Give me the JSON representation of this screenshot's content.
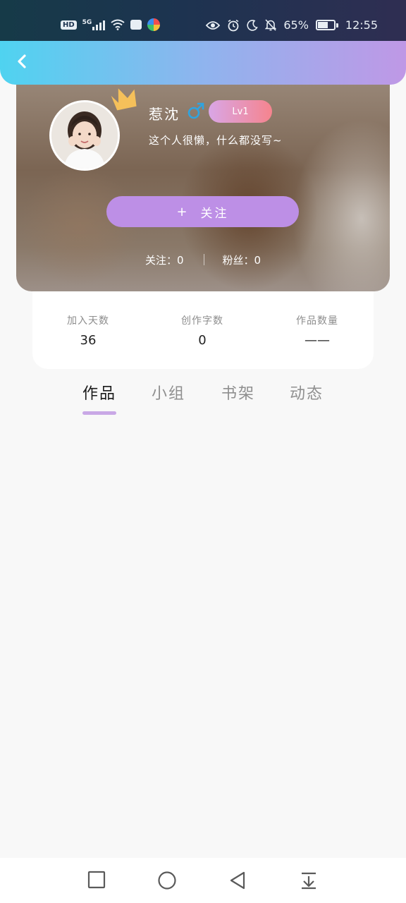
{
  "status_bar": {
    "hd": "HD",
    "network": "5G",
    "battery_percent": "65%",
    "battery_level": 0.65,
    "time": "12:55",
    "icons": [
      "hd-icon",
      "signal-icon",
      "wifi-icon",
      "app-store-icon",
      "colorful-app-icon",
      "eye-icon",
      "alarm-icon",
      "moon-icon",
      "bell-off-icon",
      "battery-icon"
    ]
  },
  "header": {
    "back_icon": "chevron-left-icon"
  },
  "profile": {
    "name": "惹沈",
    "gender_symbol": "♂",
    "level": "Lv1",
    "bio": "这个人很懒，什么都没写~",
    "follow_button": "关注",
    "follow_plus": "+",
    "following_label": "关注：",
    "following_count": "0",
    "fans_label": "粉丝：",
    "fans_count": "0",
    "colors": {
      "follow_button": "#bd8fe6",
      "level_start": "#d9a6e6",
      "level_end": "#f5848e",
      "male": "#2fa4e0",
      "crown": "#f5c05a"
    }
  },
  "stats": [
    {
      "label": "加入天数",
      "value": "36"
    },
    {
      "label": "创作字数",
      "value": "0"
    },
    {
      "label": "作品数量",
      "value": "——"
    }
  ],
  "tabs": [
    {
      "label": "作品",
      "active": true
    },
    {
      "label": "小组",
      "active": false
    },
    {
      "label": "书架",
      "active": false
    },
    {
      "label": "动态",
      "active": false
    }
  ],
  "nav_bar": {
    "buttons": [
      "square-icon",
      "circle-icon",
      "back-triangle-icon",
      "pull-down-icon"
    ]
  }
}
